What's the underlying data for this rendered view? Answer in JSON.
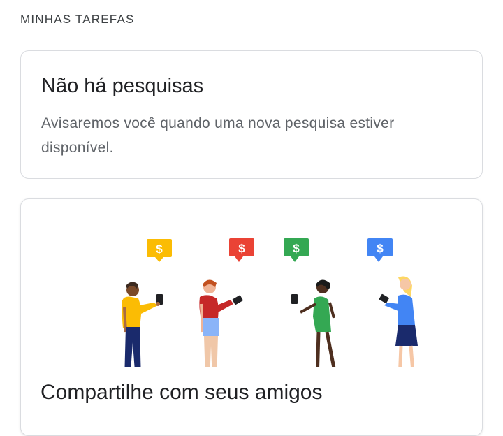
{
  "section": {
    "title": "MINHAS TAREFAS"
  },
  "empty_card": {
    "title": "Não há pesquisas",
    "body": "Avisaremos você quando uma nova pesquisa estiver disponível."
  },
  "share_card": {
    "title": "Compartilhe com seus amigos",
    "illustration": {
      "bubble_symbol": "$",
      "bubble_colors": [
        "#fbbc04",
        "#ea4335",
        "#34a853",
        "#4285f4"
      ]
    }
  }
}
